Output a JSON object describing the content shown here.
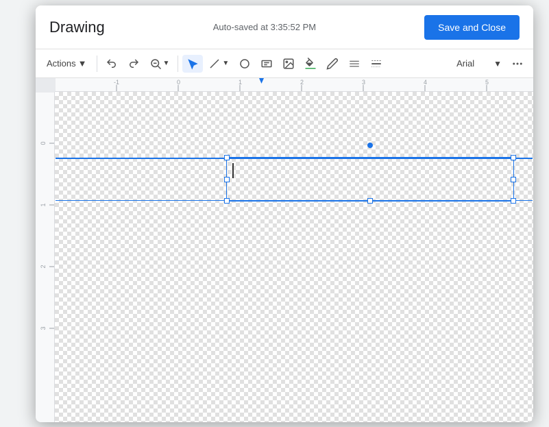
{
  "dialog": {
    "title": "Drawing",
    "autosave": "Auto-saved at 3:35:52 PM",
    "save_close_label": "Save and Close"
  },
  "toolbar": {
    "actions_label": "Actions",
    "undo_label": "Undo",
    "redo_label": "Redo",
    "zoom_label": "Zoom",
    "select_label": "Select",
    "line_label": "Line",
    "shape_label": "Shape",
    "text_label": "Text box",
    "image_label": "Image",
    "fill_label": "Fill color",
    "pen_label": "Pen",
    "border_label": "Border",
    "border2_label": "Border style",
    "font_name": "Arial",
    "more_label": "More"
  },
  "canvas": {
    "textbox_content": ""
  }
}
